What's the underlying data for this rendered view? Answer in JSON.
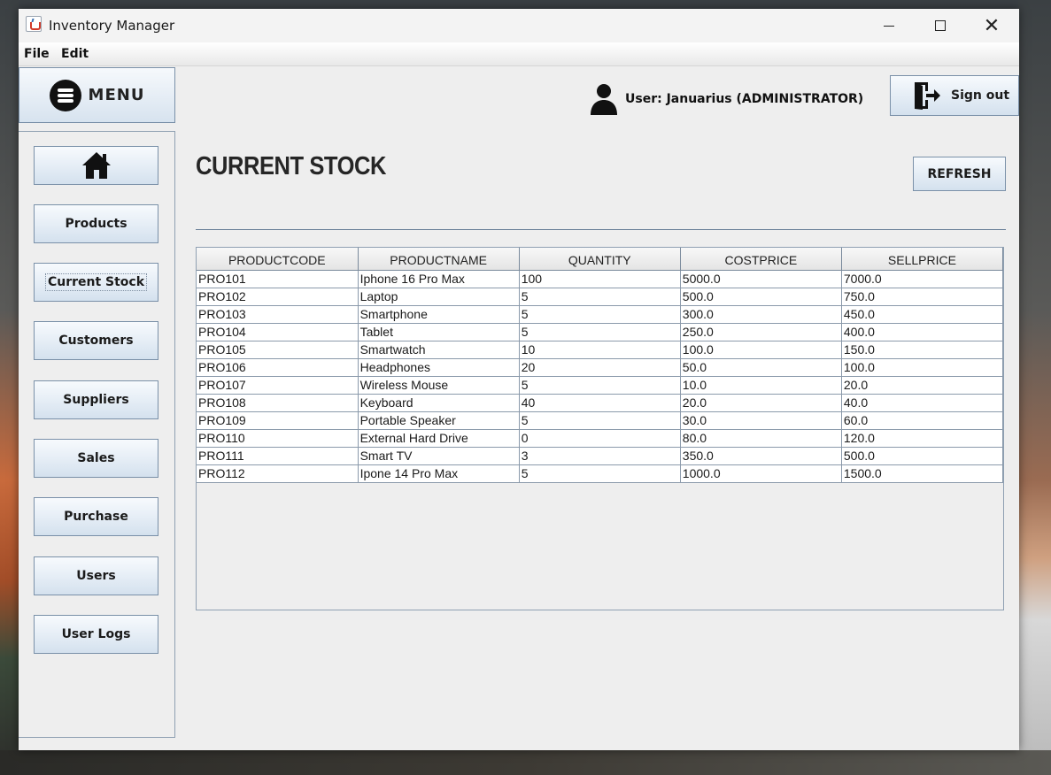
{
  "window": {
    "title": "Inventory Manager",
    "minimize_label": "",
    "maximize_label": "",
    "close_label": "✕"
  },
  "menubar": {
    "items": [
      {
        "label": "File"
      },
      {
        "label": "Edit"
      }
    ]
  },
  "sidebar": {
    "header_label": "MENU",
    "items": [
      {
        "label": "",
        "icon": "home-icon"
      },
      {
        "label": "Products"
      },
      {
        "label": "Current Stock",
        "selected": true
      },
      {
        "label": "Customers"
      },
      {
        "label": "Suppliers"
      },
      {
        "label": "Sales"
      },
      {
        "label": "Purchase"
      },
      {
        "label": "Users"
      },
      {
        "label": "User Logs"
      }
    ]
  },
  "header": {
    "user_text": "User: Januarius (ADMINISTRATOR)",
    "user_icon": "user-icon",
    "signout_label": "Sign out",
    "signout_icon": "sign-out-icon"
  },
  "main": {
    "title": "CURRENT STOCK",
    "refresh_label": "REFRESH",
    "table": {
      "columns": [
        "PRODUCTCODE",
        "PRODUCTNAME",
        "QUANTITY",
        "COSTPRICE",
        "SELLPRICE"
      ],
      "rows": [
        [
          "PRO101",
          "Iphone 16 Pro Max",
          "100",
          "5000.0",
          "7000.0"
        ],
        [
          "PRO102",
          "Laptop",
          "5",
          "500.0",
          "750.0"
        ],
        [
          "PRO103",
          "Smartphone",
          "5",
          "300.0",
          "450.0"
        ],
        [
          "PRO104",
          "Tablet",
          "5",
          "250.0",
          "400.0"
        ],
        [
          "PRO105",
          "Smartwatch",
          "10",
          "100.0",
          "150.0"
        ],
        [
          "PRO106",
          "Headphones",
          "20",
          "50.0",
          "100.0"
        ],
        [
          "PRO107",
          "Wireless Mouse",
          "5",
          "10.0",
          "20.0"
        ],
        [
          "PRO108",
          "Keyboard",
          "40",
          "20.0",
          "40.0"
        ],
        [
          "PRO109",
          "Portable Speaker",
          "5",
          "30.0",
          "60.0"
        ],
        [
          "PRO110",
          "External Hard Drive",
          "0",
          "80.0",
          "120.0"
        ],
        [
          "PRO111",
          "Smart TV",
          "3",
          "350.0",
          "500.0"
        ],
        [
          "PRO112",
          "Ipone 14 Pro Max",
          "5",
          "1000.0",
          "1500.0"
        ]
      ]
    }
  },
  "colors": {
    "button_border": "#7a90a8",
    "button_gradient_top": "#f7fafd",
    "button_gradient_bottom": "#d4e1ee",
    "window_bg": "#eeeeee"
  }
}
